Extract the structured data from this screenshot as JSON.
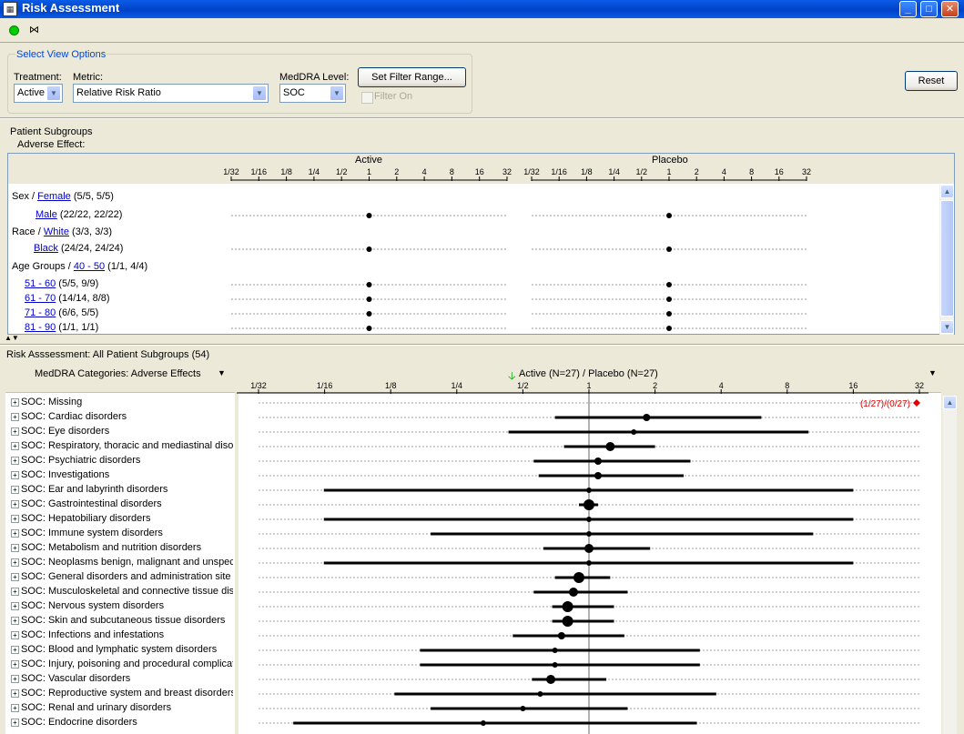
{
  "window": {
    "title": "Risk Assessment",
    "minimize": "_",
    "maximize": "□",
    "close": "✕"
  },
  "toolbar": {
    "icons": [
      "status-green-icon",
      "bowtie-icon"
    ],
    "bowtie_glyph": "⋈"
  },
  "view_options": {
    "title": "Select View Options",
    "treatment_label": "Treatment:",
    "treatment_value": "Active",
    "metric_label": "Metric:",
    "metric_value": "Relative Risk Ratio",
    "meddra_label": "MedDRA Level:",
    "meddra_value": "SOC",
    "filter_button": "Set Filter Range...",
    "filter_on_label": "Filter On",
    "reset_button": "Reset"
  },
  "subgroups": {
    "title": "Patient Subgroups",
    "subtitle": "Adverse Effect:",
    "active_header": "Active",
    "placebo_header": "Placebo",
    "ticks": [
      "1/32",
      "1/16",
      "1/8",
      "1/4",
      "1/2",
      "1",
      "2",
      "4",
      "8",
      "16",
      "32"
    ],
    "rows": [
      {
        "prefix": "Sex / ",
        "link": "Female",
        "counts": " (5/5, 5/5)",
        "indent": 0,
        "point": false
      },
      {
        "prefix": "",
        "link": "Male",
        "counts": " (22/22, 22/22)",
        "indent": 1,
        "point": true
      },
      {
        "prefix": "Race / ",
        "link": "White",
        "counts": " (3/3, 3/3)",
        "indent": 0,
        "point": false
      },
      {
        "prefix": "",
        "link": "Black",
        "counts": " (24/24, 24/24)",
        "indent": 1,
        "point": true
      },
      {
        "prefix": "Age Groups / ",
        "link": "40 - 50",
        "counts": " (1/1, 4/4)",
        "indent": 0,
        "point": false
      },
      {
        "prefix": "",
        "link": "51 - 60",
        "counts": " (5/5, 9/9)",
        "indent": 1,
        "point": true
      },
      {
        "prefix": "",
        "link": "61 - 70",
        "counts": " (14/14, 8/8)",
        "indent": 1,
        "point": true
      },
      {
        "prefix": "",
        "link": "71 - 80",
        "counts": " (6/6, 5/5)",
        "indent": 1,
        "point": true
      },
      {
        "prefix": "",
        "link": "81 - 90",
        "counts": " (1/1, 1/1)",
        "indent": 1,
        "point": true
      }
    ]
  },
  "bottom": {
    "title": "Risk Asssessment: All Patient Subgroups (54)",
    "left_header": "MedDRA Categories: Adverse Effects",
    "plot_header": "Active (N=27) / Placebo (N=27)",
    "missing_annotation": "(1/27)/(0/27)"
  },
  "chart_data": {
    "type": "scatter",
    "title": "Active (N=27) / Placebo (N=27)",
    "x_scale": "log2",
    "xlim": [
      0.03125,
      32
    ],
    "ticks": [
      "1/32",
      "1/16",
      "1/8",
      "1/4",
      "1/2",
      "1",
      "2",
      "4",
      "8",
      "16",
      "32"
    ],
    "reference_line": 1,
    "categories": [
      "SOC: Missing",
      "SOC: Cardiac disorders",
      "SOC: Eye disorders",
      "SOC: Respiratory, thoracic and mediastinal disorders",
      "SOC: Psychiatric disorders",
      "SOC: Investigations",
      "SOC: Ear and labyrinth disorders",
      "SOC: Gastrointestinal disorders",
      "SOC: Hepatobiliary disorders",
      "SOC: Immune system disorders",
      "SOC: Metabolism and nutrition disorders",
      "SOC: Neoplasms benign, malignant and unspecified",
      "SOC: General disorders and administration site",
      "SOC: Musculoskeletal and connective tissue disorders",
      "SOC: Nervous system disorders",
      "SOC: Skin and subcutaneous tissue disorders",
      "SOC: Infections and infestations",
      "SOC: Blood and lymphatic system disorders",
      "SOC: Injury, poisoning and procedural complications",
      "SOC: Vascular disorders",
      "SOC: Reproductive system and breast disorders",
      "SOC: Renal and urinary disorders",
      "SOC: Endocrine disorders"
    ],
    "estimates": [
      null,
      1.83,
      1.6,
      1.25,
      1.1,
      1.1,
      1.0,
      1.0,
      1.0,
      1.0,
      1.0,
      1.0,
      0.9,
      0.85,
      0.8,
      0.8,
      0.75,
      0.7,
      0.7,
      0.67,
      0.6,
      0.5,
      0.33
    ],
    "ci_low": [
      null,
      0.7,
      0.43,
      0.77,
      0.56,
      0.59,
      0.062,
      0.9,
      0.062,
      0.19,
      0.62,
      0.062,
      0.7,
      0.56,
      0.68,
      0.68,
      0.45,
      0.17,
      0.17,
      0.55,
      0.13,
      0.19,
      0.045
    ],
    "ci_high": [
      null,
      6.1,
      10,
      2,
      2.9,
      2.7,
      16,
      1.1,
      16,
      10.5,
      1.9,
      16,
      1.25,
      1.5,
      1.3,
      1.3,
      1.45,
      3.2,
      3.2,
      1.2,
      3.8,
      1.5,
      3.1
    ],
    "marker_size": [
      0,
      4,
      3,
      5,
      4,
      4,
      3,
      6,
      3,
      3,
      5,
      3,
      6,
      5,
      6,
      6,
      4,
      3,
      3,
      5,
      3,
      3,
      3
    ],
    "missing_marker_value": 32,
    "missing_color": "#e00000"
  }
}
